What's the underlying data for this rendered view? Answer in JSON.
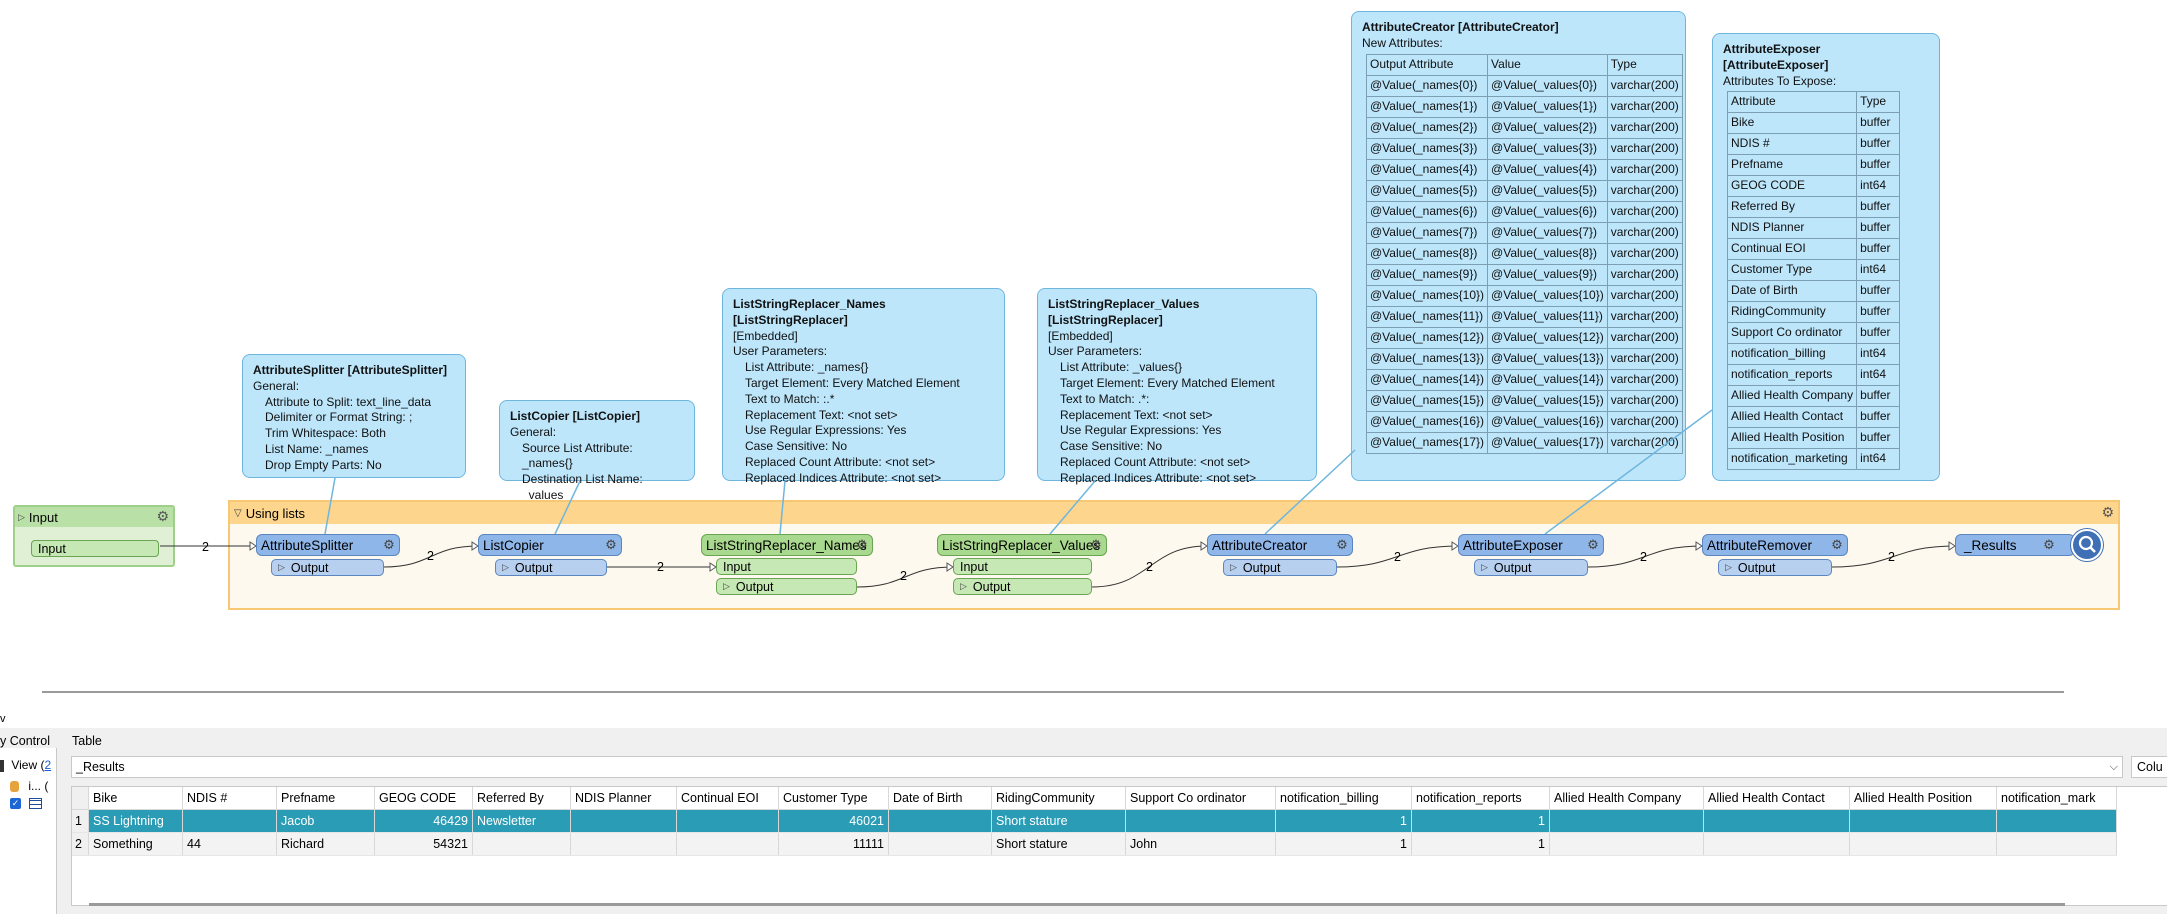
{
  "canvas": {
    "input_bookmark": {
      "title": "Input",
      "port": "Input",
      "count": "2"
    },
    "using_lists": {
      "title": "Using lists"
    },
    "transformers": [
      {
        "name": "AttributeSplitter",
        "ports": [
          "Output"
        ],
        "color": "blue"
      },
      {
        "name": "ListCopier",
        "ports": [
          "Output"
        ],
        "color": "blue"
      },
      {
        "name": "ListStringReplacer_Names",
        "ports": [
          "Input",
          "Output"
        ],
        "color": "green"
      },
      {
        "name": "ListStringReplacer_Values",
        "ports": [
          "Input",
          "Output"
        ],
        "color": "green"
      },
      {
        "name": "AttributeCreator",
        "ports": [
          "Output"
        ],
        "color": "blue"
      },
      {
        "name": "AttributeExposer",
        "ports": [
          "Output"
        ],
        "color": "blue"
      },
      {
        "name": "AttributeRemover",
        "ports": [
          "Output"
        ],
        "color": "blue"
      },
      {
        "name": "_Results",
        "ports": [],
        "color": "blue"
      }
    ],
    "counts": [
      "2",
      "2",
      "2",
      "2",
      "2",
      "2",
      "2"
    ]
  },
  "tooltips": {
    "splitter": {
      "title": "AttributeSplitter [AttributeSplitter]",
      "lines": [
        "General:",
        "Attribute to Split: text_line_data",
        "Delimiter or Format String: ;",
        "Trim Whitespace: Both",
        "List Name: _names",
        "Drop Empty Parts: No"
      ]
    },
    "copier": {
      "title": "ListCopier [ListCopier]",
      "lines": [
        "General:",
        "Source List Attribute: _names{}",
        "Destination List Name: _values"
      ]
    },
    "lsr_names": {
      "title": "ListStringReplacer_Names [ListStringReplacer]",
      "lines": [
        "[Embedded]",
        "User Parameters:",
        "List Attribute: _names{}",
        "Target Element: Every Matched Element",
        "Text to Match: :.*",
        "Replacement Text: <not set>",
        "Use Regular Expressions: Yes",
        "Case Sensitive: No",
        "Replaced Count Attribute: <not set>",
        "Replaced Indices Attribute: <not set>"
      ]
    },
    "lsr_values": {
      "title": "ListStringReplacer_Values [ListStringReplacer]",
      "lines": [
        "[Embedded]",
        "User Parameters:",
        "List Attribute: _values{}",
        "Target Element: Every Matched Element",
        "Text to Match: .*:",
        "Replacement Text: <not set>",
        "Use Regular Expressions: Yes",
        "Case Sensitive: No",
        "Replaced Count Attribute: <not set>",
        "Replaced Indices Attribute: <not set>"
      ]
    },
    "creator": {
      "title": "AttributeCreator [AttributeCreator]",
      "subtitle": "New Attributes:",
      "headers": [
        "Output Attribute",
        "Value",
        "Type"
      ],
      "rows": [
        [
          "@Value(_names{0})",
          "@Value(_values{0})",
          "varchar(200)"
        ],
        [
          "@Value(_names{1})",
          "@Value(_values{1})",
          "varchar(200)"
        ],
        [
          "@Value(_names{2})",
          "@Value(_values{2})",
          "varchar(200)"
        ],
        [
          "@Value(_names{3})",
          "@Value(_values{3})",
          "varchar(200)"
        ],
        [
          "@Value(_names{4})",
          "@Value(_values{4})",
          "varchar(200)"
        ],
        [
          "@Value(_names{5})",
          "@Value(_values{5})",
          "varchar(200)"
        ],
        [
          "@Value(_names{6})",
          "@Value(_values{6})",
          "varchar(200)"
        ],
        [
          "@Value(_names{7})",
          "@Value(_values{7})",
          "varchar(200)"
        ],
        [
          "@Value(_names{8})",
          "@Value(_values{8})",
          "varchar(200)"
        ],
        [
          "@Value(_names{9})",
          "@Value(_values{9})",
          "varchar(200)"
        ],
        [
          "@Value(_names{10})",
          "@Value(_values{10})",
          "varchar(200)"
        ],
        [
          "@Value(_names{11})",
          "@Value(_values{11})",
          "varchar(200)"
        ],
        [
          "@Value(_names{12})",
          "@Value(_values{12})",
          "varchar(200)"
        ],
        [
          "@Value(_names{13})",
          "@Value(_values{13})",
          "varchar(200)"
        ],
        [
          "@Value(_names{14})",
          "@Value(_values{14})",
          "varchar(200)"
        ],
        [
          "@Value(_names{15})",
          "@Value(_values{15})",
          "varchar(200)"
        ],
        [
          "@Value(_names{16})",
          "@Value(_values{16})",
          "varchar(200)"
        ],
        [
          "@Value(_names{17})",
          "@Value(_values{17})",
          "varchar(200)"
        ]
      ]
    },
    "exposer": {
      "title": "AttributeExposer [AttributeExposer]",
      "subtitle": "Attributes To Expose:",
      "headers": [
        "Attribute",
        "Type"
      ],
      "rows": [
        [
          "Bike",
          "buffer"
        ],
        [
          "NDIS #",
          "buffer"
        ],
        [
          "Prefname",
          "buffer"
        ],
        [
          "GEOG CODE",
          "int64"
        ],
        [
          "Referred By",
          "buffer"
        ],
        [
          "NDIS Planner",
          "buffer"
        ],
        [
          "Continual EOI",
          "buffer"
        ],
        [
          "Customer Type",
          "int64"
        ],
        [
          "Date of Birth",
          "buffer"
        ],
        [
          "RidingCommunity",
          "buffer"
        ],
        [
          "Support Co ordinator",
          "buffer"
        ],
        [
          "notification_billing",
          "int64"
        ],
        [
          "notification_reports",
          "int64"
        ],
        [
          "Allied Health Company",
          "buffer"
        ],
        [
          "Allied Health Contact",
          "buffer"
        ],
        [
          "Allied Health Position",
          "buffer"
        ],
        [
          "notification_marketing",
          "int64"
        ]
      ]
    }
  },
  "lower": {
    "left_edge": "v",
    "left_label": "y Control",
    "left_items": [
      "View (",
      "2",
      "i... ("
    ],
    "table_tab": "Table",
    "result_combo": "_Results",
    "columns_btn": "Colu",
    "headers": [
      "Bike",
      "NDIS #",
      "Prefname",
      "GEOG CODE",
      "Referred By",
      "NDIS Planner",
      "Continual EOI",
      "Customer Type",
      "Date of Birth",
      "RidingCommunity",
      "Support Co ordinator",
      "notification_billing",
      "notification_reports",
      "Allied Health Company",
      "Allied Health Contact",
      "Allied Health Position",
      "notification_mark"
    ],
    "rows": [
      [
        "1",
        "SS Lightning",
        "",
        "Jacob",
        "46429",
        "Newsletter",
        "",
        "",
        "46021",
        "",
        "Short stature",
        "",
        "1",
        "1",
        "",
        "",
        "",
        ""
      ],
      [
        "2",
        "Something",
        "44",
        "Richard",
        "54321",
        "",
        "",
        "",
        "11111",
        "",
        "Short stature",
        "John",
        "1",
        "1",
        "",
        "",
        "",
        ""
      ]
    ]
  },
  "colors": {
    "selected_row": "#2b9cb5",
    "tooltip_bg": "#bde6fb",
    "bookmark_border": "#f7c874"
  }
}
